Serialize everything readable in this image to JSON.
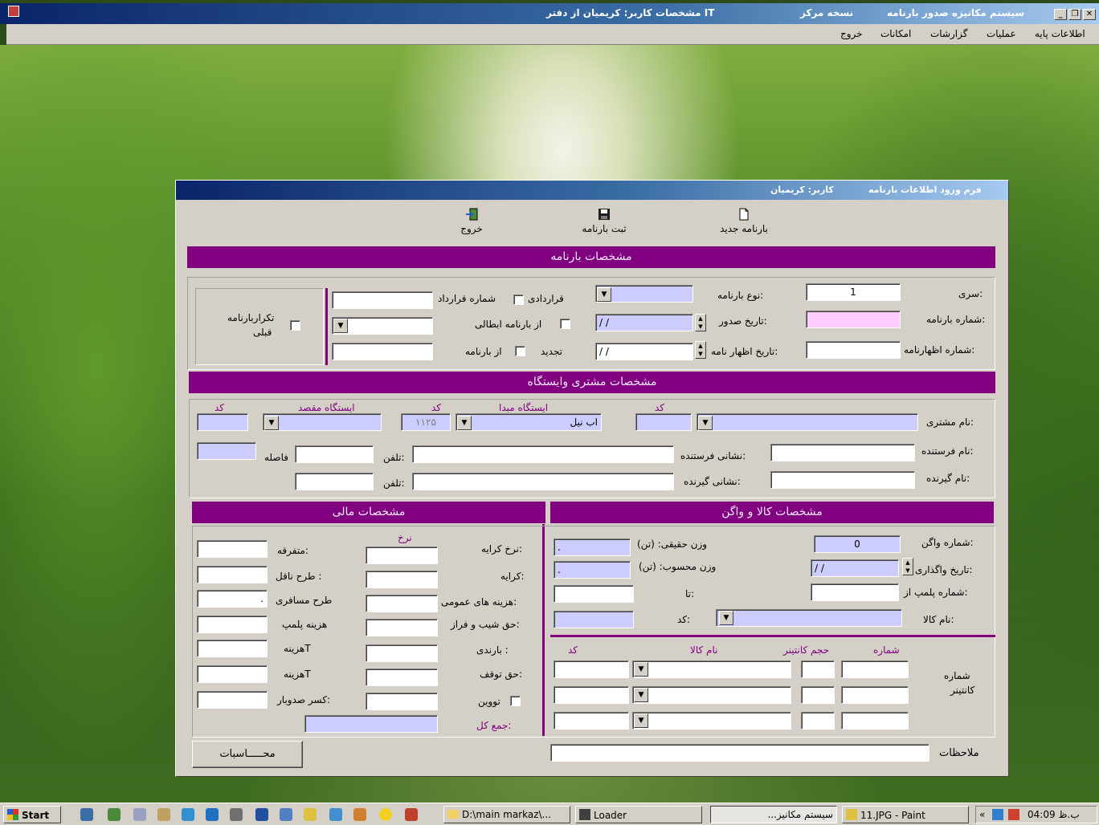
{
  "app": {
    "title_left": "سیستم مکانیزه صدور بارنامه",
    "title_mid": "نسخه مرکز",
    "title_right": "مشخصات کاربر: کریمیان از دفتر IT",
    "menu": [
      "اطلاعات پایه",
      "عملیات",
      "گزارشات",
      "امکانات",
      "خروج"
    ]
  },
  "dialog": {
    "title": "فرم ورود اطلاعات بارنامه",
    "user": "کاربر: کریمیان",
    "toolbar": {
      "new": "بارنامه جدید",
      "save": "ثبت بارنامه",
      "exit": "خروج"
    },
    "sections": {
      "waybill": "مشخصات بارنامه",
      "customer": "مشخصات مشتری وایستگاه",
      "goods": "مشخصات کالا و واگن",
      "financial": "مشخصات مالی"
    },
    "waybill": {
      "series_label": "سری:",
      "series_value": "1",
      "number_label": "شماره بارنامه:",
      "declaration_label": "شماره اظهارنامه:",
      "type_label": "نوع بارنامه:",
      "issue_date_label": "تاریخ صدور:",
      "issue_date_value": "/ /",
      "declaration_date_label": "تاریخ اظهار نامه:",
      "declaration_date_value": "/ /",
      "contract_label": "قراردادی",
      "contract_no_label": "شماره قرارداد",
      "cancelled_label": "از بارنامه ابطالی",
      "renew_label": "تجدید",
      "from_waybill_label": "از بارنامه",
      "repeat_label_1": "تکراربارنامه",
      "repeat_label_2": "قبلی"
    },
    "customer": {
      "code_header": "کد",
      "origin_header": "ایستگاه مبدا",
      "dest_header": "ایستگاه مقصد",
      "customer_name_label": "نام مشتری:",
      "origin_value": "اب نیل",
      "origin_code": "۱۱۲۵",
      "distance_label": "فاصله",
      "sender_name_label": "نام فرستنده:",
      "sender_address_label": "نشانی فرستنده:",
      "phone_label": "تلفن:",
      "receiver_name_label": "نام گیرنده:",
      "receiver_address_label": "نشانی گیرنده:"
    },
    "goods": {
      "wagon_no_label": "شماره واگن:",
      "wagon_no_value": "0",
      "assign_date_label": "تاریخ واگذاری:",
      "assign_date_value": "/ /",
      "seal_label": "شماره پلمپ  از:",
      "to_label": "تا:",
      "goods_name_label": "نام کالا:",
      "code_label": "کد:",
      "real_weight_label": "وزن حقیقی: (تن)",
      "real_weight_value": ".",
      "calc_weight_label": "وزن محسوب: (تن)",
      "calc_weight_value": ".",
      "container_label_1": "شماره",
      "container_label_2": "کانتینر",
      "col_number": "شماره",
      "col_volume": "حجم کانتینر",
      "col_goods": "نام کالا",
      "col_code": "کد"
    },
    "financial": {
      "rate_header": "نرخ",
      "fare_rate_label": "نرخ کرایه:",
      "fare_label": "کرایه:",
      "public_cost_label": "هزینه های عمومی:",
      "slope_label": "حق شیب و فراز:",
      "receivable_label": "بارندی :",
      "stop_label": "حق توقف:",
      "toveen_label": "تووین",
      "total_label": "جمع کل:",
      "misc_label": "متفرقه:",
      "plan_label": "طرح ناقل :",
      "passenger_plan_label": "طرح مسافری",
      "passenger_plan_value": ".",
      "seal_cost_label": "هزینه پلمپ",
      "cost_a_label": "هزینهT",
      "cost_b_label": "هزینهT",
      "deduction_label": "کسر صدوبار:",
      "calc_button": "محـــــاسبات"
    },
    "notes_label": "ملاحظات"
  },
  "taskbar": {
    "start": "Start",
    "tasks": [
      "D:\\main markaz\\...",
      "Loader",
      "سیستم مکانیز...",
      "11.JPG - Paint"
    ],
    "clock": "04:09 ب.ظ"
  }
}
